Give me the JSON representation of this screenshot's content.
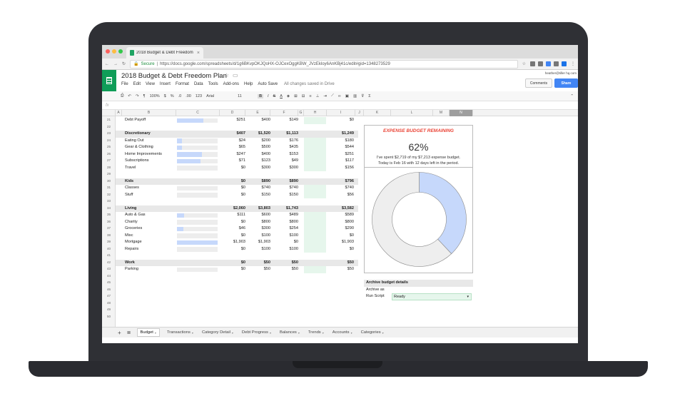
{
  "browser": {
    "tab_title": "2018 Budget & Debt Freedom",
    "tab_close": "×",
    "secure_label": "Secure",
    "url": "https://docs.google.com/spreadsheets/d/1g6BKvpOKJQoHX-OJCexOggKBW_JVzEkloy6AnKBj41c/edit#gid=1348273529"
  },
  "doc": {
    "title": "2018 Budget & Debt Freedom Plan",
    "menu": [
      "File",
      "Edit",
      "View",
      "Insert",
      "Format",
      "Data",
      "Tools",
      "Add-ons",
      "Help",
      "Auto Save"
    ],
    "saved_status": "All changes saved in Drive",
    "user_email": "heather@tiller hq.com",
    "comments_label": "Comments",
    "share_label": "Share"
  },
  "toolbar": {
    "zoom": "100%",
    "currency": "$",
    "percent": "%",
    "dec0": ".0",
    "dec00": ".00",
    "more_formats": "123",
    "font": "Arial",
    "font_size": "11",
    "bold": "B",
    "italic": "I",
    "strike": "S",
    "text_color": "A",
    "sigma": "Σ"
  },
  "formula_label": "fx",
  "columns": [
    "A",
    "B",
    "C",
    "D",
    "E",
    "F",
    "G",
    "H",
    "I",
    "J",
    "K",
    "L",
    "M",
    "N"
  ],
  "row_numbers": [
    "21",
    "22",
    "23",
    "24",
    "25",
    "26",
    "27",
    "28",
    "29",
    "30",
    "31",
    "32",
    "33",
    "34",
    "35",
    "36",
    "37",
    "38",
    "39",
    "40",
    "41",
    "42",
    "43",
    "44",
    "45",
    "46",
    "47",
    "48",
    "49",
    "50"
  ],
  "budget_rows": [
    {
      "label": "Debt Payoff",
      "type": "item",
      "bar": 0.65,
      "d": "$251",
      "e": "$400",
      "f": "$149",
      "i": "$0"
    },
    {
      "label": "",
      "type": "blank"
    },
    {
      "label": "Discretionary",
      "type": "header",
      "d": "$407",
      "e": "$1,520",
      "f": "$1,113",
      "i": "$1,249"
    },
    {
      "label": "Eating Out",
      "type": "item",
      "bar": 0.12,
      "d": "$24",
      "e": "$200",
      "f": "$176",
      "i": "$180"
    },
    {
      "label": "Gear & Clothing",
      "type": "item",
      "bar": 0.13,
      "d": "$65",
      "e": "$500",
      "f": "$435",
      "i": "$544"
    },
    {
      "label": "Home Improvements",
      "type": "item",
      "bar": 0.62,
      "d": "$247",
      "e": "$400",
      "f": "$153",
      "i": "$251"
    },
    {
      "label": "Subscriptions",
      "type": "item",
      "bar": 0.58,
      "d": "$71",
      "e": "$123",
      "f": "$49",
      "i": "$117"
    },
    {
      "label": "Travel",
      "type": "item",
      "bar": 0,
      "d": "$0",
      "e": "$300",
      "f": "$300",
      "i": "$156"
    },
    {
      "label": "",
      "type": "blank"
    },
    {
      "label": "Kids",
      "type": "header",
      "d": "$0",
      "e": "$890",
      "f": "$890",
      "i": "$796"
    },
    {
      "label": "Classes",
      "type": "item",
      "bar": 0,
      "d": "$0",
      "e": "$740",
      "f": "$740",
      "i": "$740"
    },
    {
      "label": "Stuff",
      "type": "item",
      "bar": 0,
      "d": "$0",
      "e": "$150",
      "f": "$150",
      "i": "$56"
    },
    {
      "label": "",
      "type": "blank"
    },
    {
      "label": "Living",
      "type": "header",
      "d": "$2,060",
      "e": "$3,803",
      "f": "$1,743",
      "i": "$3,582"
    },
    {
      "label": "Auto & Gas",
      "type": "item",
      "bar": 0.18,
      "d": "$111",
      "e": "$600",
      "f": "$489",
      "i": "$589"
    },
    {
      "label": "Charity",
      "type": "item",
      "bar": 0,
      "d": "$0",
      "e": "$800",
      "f": "$800",
      "i": "$800"
    },
    {
      "label": "Groceries",
      "type": "item",
      "bar": 0.15,
      "d": "$46",
      "e": "$300",
      "f": "$254",
      "i": "$290"
    },
    {
      "label": "Misc",
      "type": "item",
      "bar": 0,
      "d": "$0",
      "e": "$100",
      "f": "$100",
      "i": "$0"
    },
    {
      "label": "Mortgage",
      "type": "item",
      "bar": 1.0,
      "d": "$1,903",
      "e": "$1,903",
      "f": "$0",
      "i": "$1,903"
    },
    {
      "label": "Repairs",
      "type": "item",
      "bar": 0,
      "d": "$0",
      "e": "$100",
      "f": "$100",
      "i": "$0"
    },
    {
      "label": "",
      "type": "blank"
    },
    {
      "label": "Work",
      "type": "header",
      "d": "$0",
      "e": "$50",
      "f": "$50",
      "i": "$50"
    },
    {
      "label": "Parking",
      "type": "item",
      "bar": 0,
      "d": "$0",
      "e": "$50",
      "f": "$50",
      "i": "$50"
    }
  ],
  "expense_panel": {
    "title": "EXPENSE BUDGET REMAINING",
    "percent": "62%",
    "line1": "I've spent $2,719 of my $7,213 expense budget.",
    "line2": "Today is Feb 16 with 12 days left in the period.",
    "chart_data": {
      "type": "pie",
      "slices": [
        {
          "name": "spent",
          "value": 0.38,
          "color": "#c6d8fb"
        },
        {
          "name": "remaining",
          "value": 0.62,
          "color": "#eeeeee"
        }
      ]
    }
  },
  "archive": {
    "header": "Archive budget details",
    "label1": "Archive as",
    "label2": "Run Script",
    "select_value": "Ready"
  },
  "sheet_tabs": [
    "Budget",
    "Transactions",
    "Category Detail",
    "Debt Progress",
    "Balances",
    "Trends",
    "Accounts",
    "Categories"
  ],
  "colors": {
    "sheets_green": "#0f9d58",
    "share_blue": "#4285f4",
    "panel_title_red": "#ea4335",
    "bar_blue": "#c6d8fb",
    "green_cell": "#e6f6ec"
  }
}
